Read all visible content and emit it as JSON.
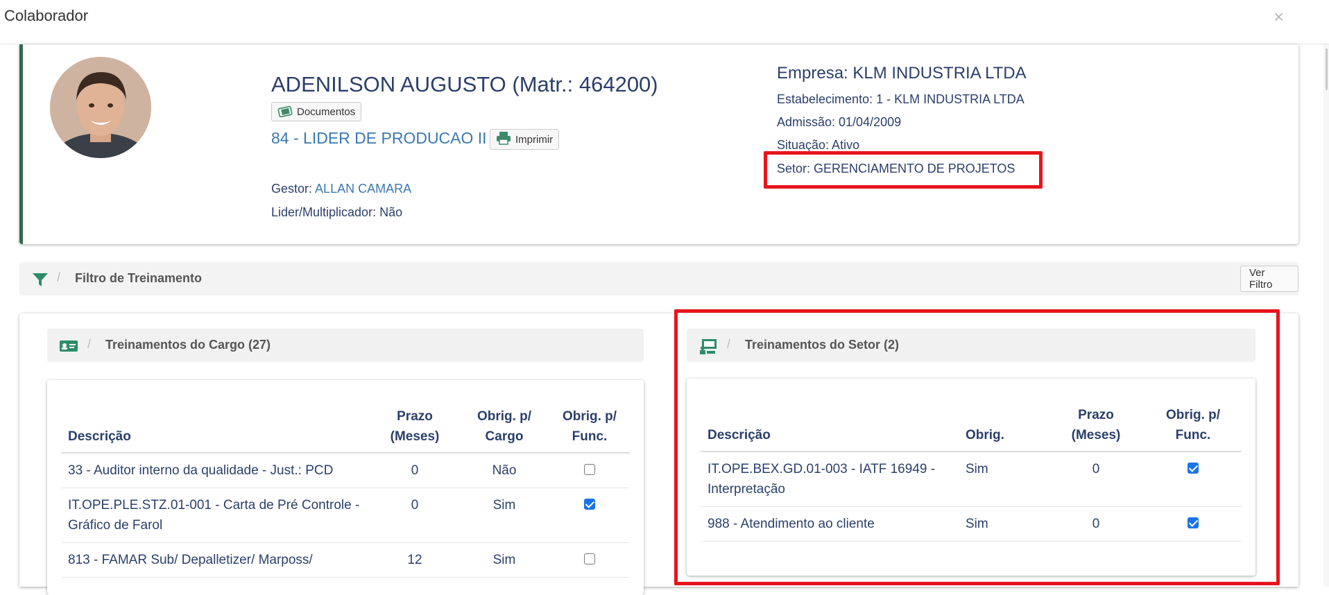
{
  "modal": {
    "title": "Colaborador",
    "close_glyph": "×"
  },
  "employee": {
    "name": "ADENILSON AUGUSTO (Matr.: 464200)",
    "documents_label": "Documentos",
    "role": "84 - LIDER DE PRODUCAO II",
    "print_label": "Imprimir",
    "gestor_label": "Gestor:",
    "gestor_value": "ALLAN CAMARA",
    "lider_label": "Lider/Multiplicador:",
    "lider_value": "Não"
  },
  "company": {
    "empresa": "Empresa: KLM INDUSTRIA LTDA",
    "estabelecimento": "Estabelecimento: 1 - KLM INDUSTRIA LTDA",
    "admissao": "Admissão: 01/04/2009",
    "situacao": "Situação: Ativo",
    "setor": "Setor: GERENCIAMENTO DE PROJETOS"
  },
  "filter": {
    "label": "Filtro de Treinamento",
    "separator": "/",
    "button": "Ver Filtro"
  },
  "cargo_section": {
    "title": "Treinamentos do Cargo (27)",
    "headers": {
      "descricao": "Descrição",
      "prazo_1": "Prazo",
      "prazo_2": "(Meses)",
      "obrig_cargo_1": "Obrig. p/",
      "obrig_cargo_2": "Cargo",
      "obrig_func_1": "Obrig. p/",
      "obrig_func_2": "Func."
    },
    "rows": [
      {
        "descricao": "33 - Auditor interno da qualidade - Just.: PCD",
        "prazo": "0",
        "obrig_cargo": "Não",
        "obrig_func": false
      },
      {
        "descricao": "IT.OPE.PLE.STZ.01-001 - Carta de Pré Controle - Gráfico de Farol",
        "prazo": "0",
        "obrig_cargo": "Sim",
        "obrig_func": true
      },
      {
        "descricao": "813 - FAMAR Sub/ Depalletizer/ Marposs/",
        "prazo": "12",
        "obrig_cargo": "Sim",
        "obrig_func": false
      }
    ]
  },
  "setor_section": {
    "title": "Treinamentos do Setor (2)",
    "headers": {
      "descricao": "Descrição",
      "obrig": "Obrig.",
      "prazo_1": "Prazo",
      "prazo_2": "(Meses)",
      "obrig_func_1": "Obrig. p/",
      "obrig_func_2": "Func."
    },
    "rows": [
      {
        "descricao": "IT.OPE.BEX.GD.01-003 - IATF 16949 - Interpretação",
        "obrig": "Sim",
        "prazo": "0",
        "obrig_func": true
      },
      {
        "descricao": "988 - Atendimento ao cliente",
        "obrig": "Sim",
        "prazo": "0",
        "obrig_func": true
      }
    ]
  },
  "colors": {
    "highlight": "#e8141c",
    "accent_border": "#2e6b4f",
    "link": "#3a78b5",
    "text": "#2b3f6b",
    "checkbox_checked": "#1a73e8"
  }
}
